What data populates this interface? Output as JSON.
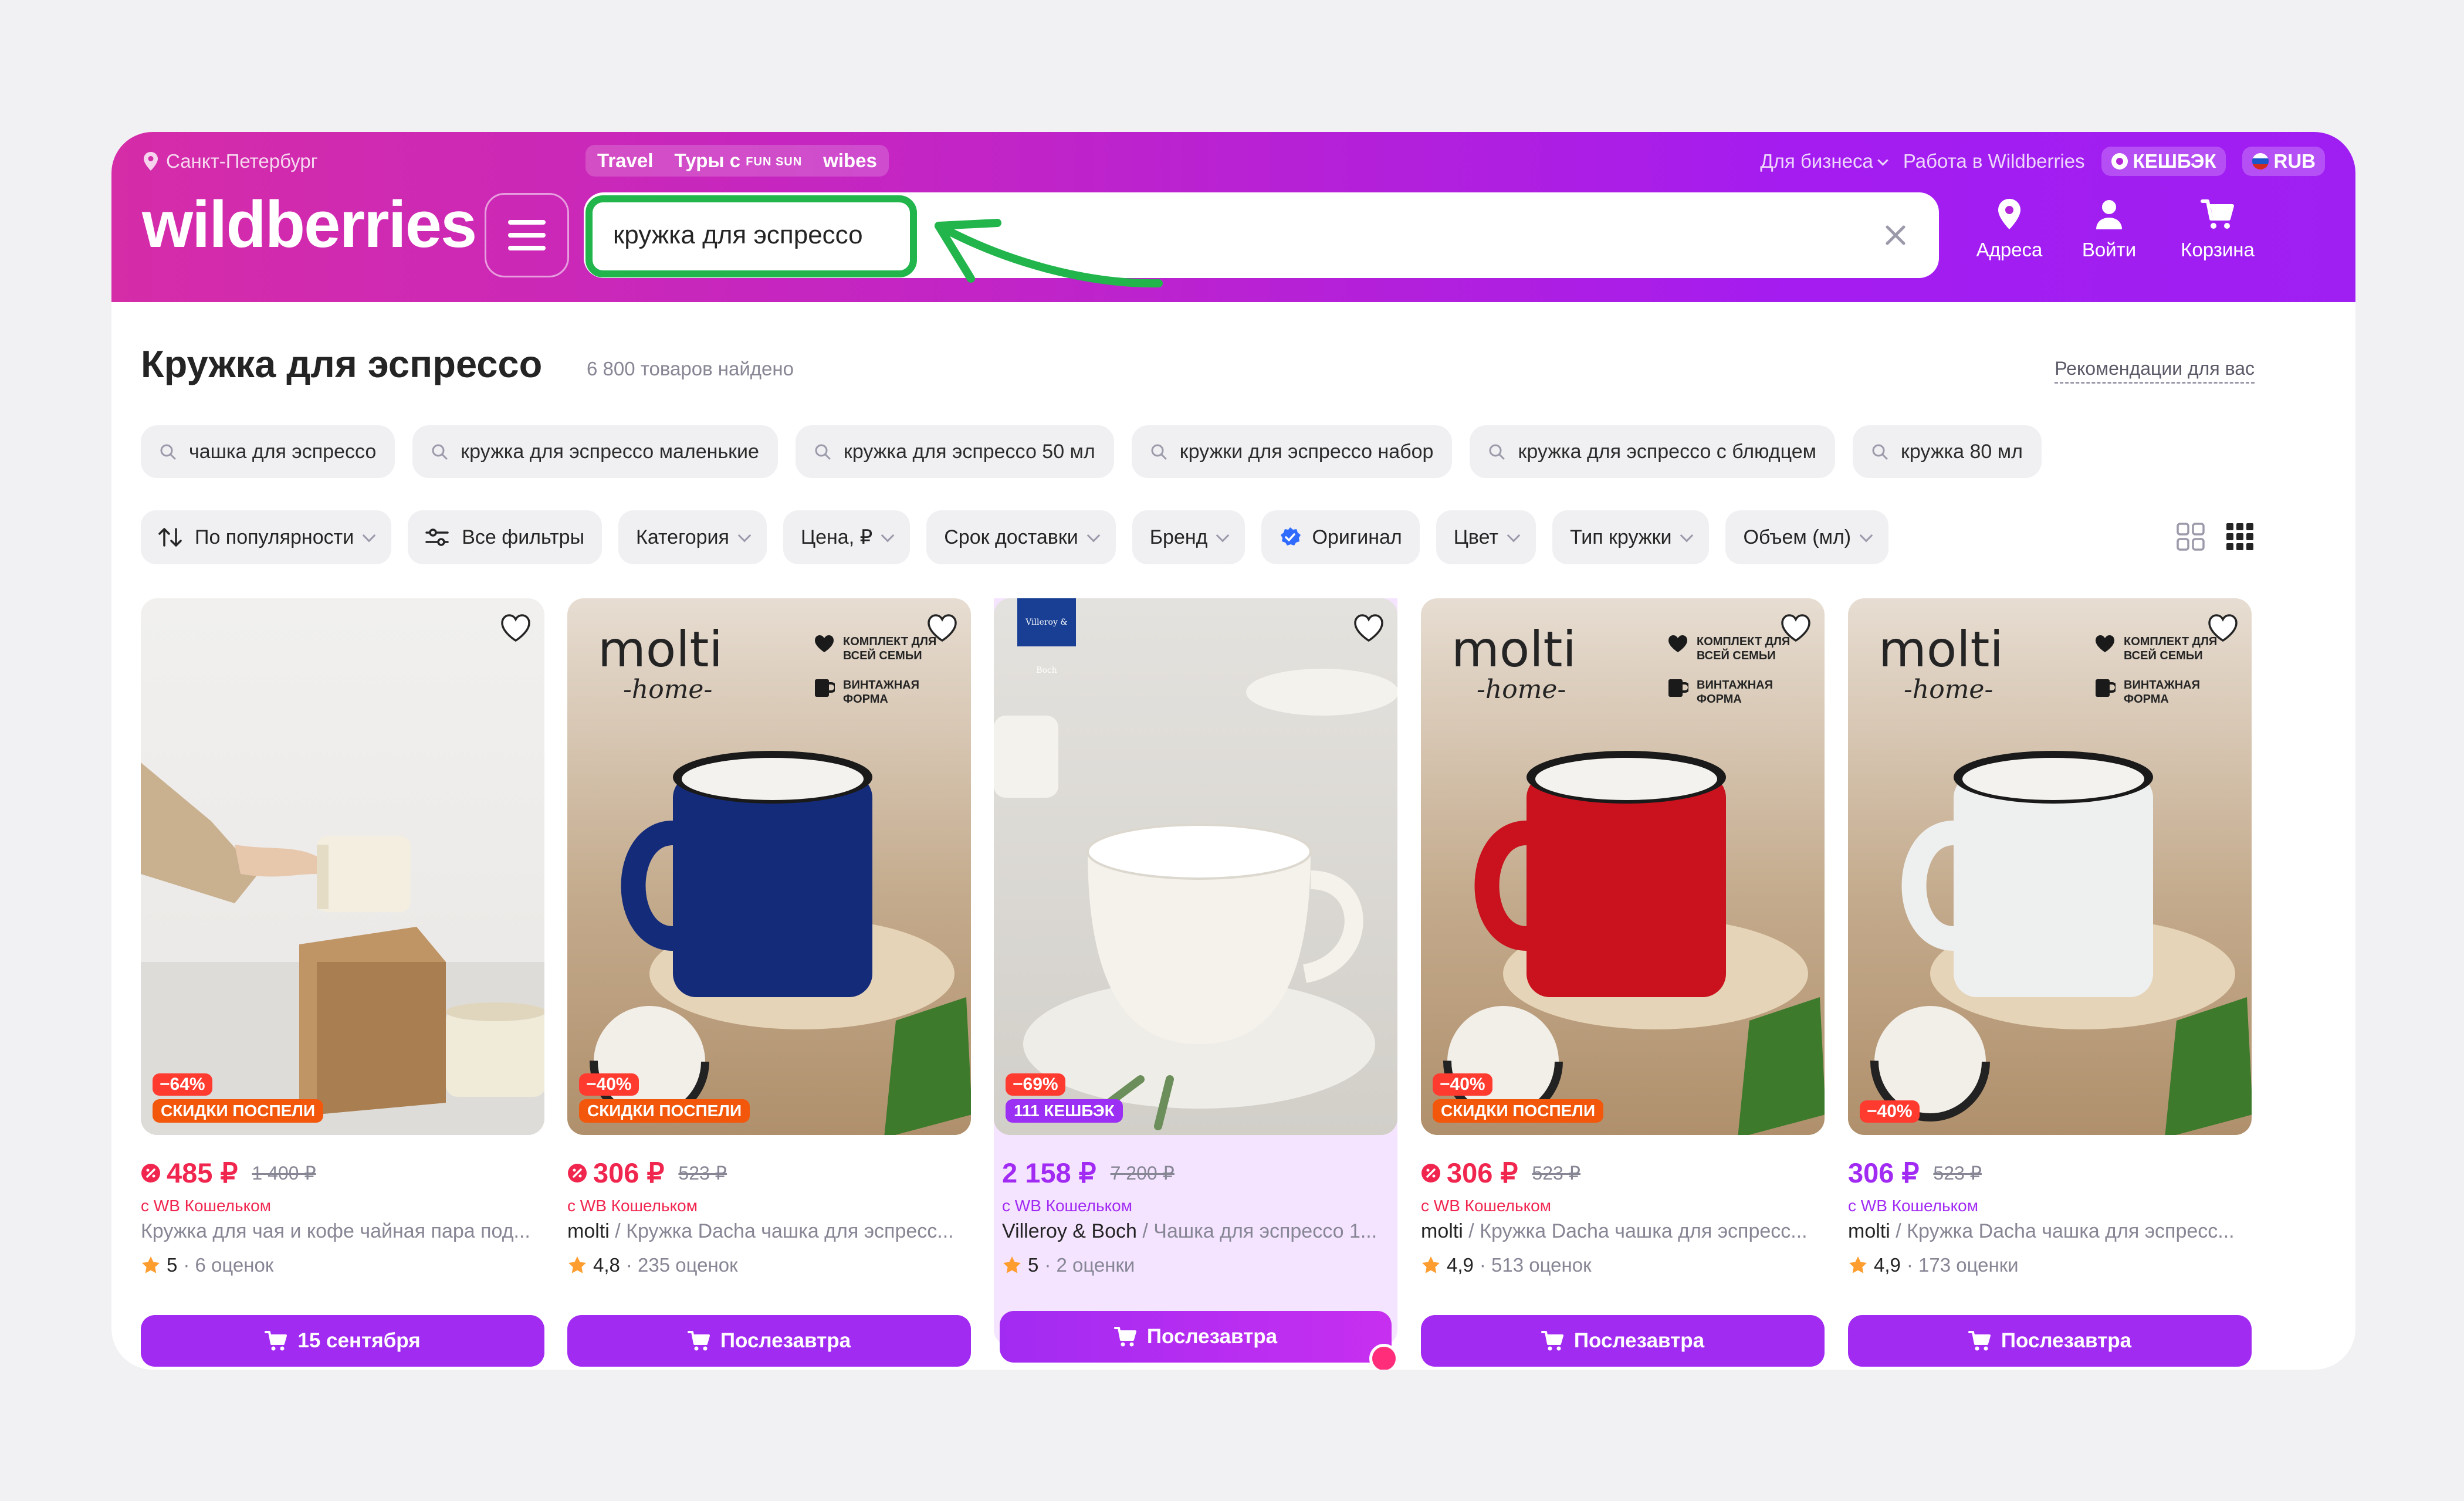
{
  "header": {
    "city": "Санкт-Петербург",
    "promo": {
      "travel": "Travel",
      "tours": "Туры с",
      "sun_logo": "FUN SUN",
      "wibes": "wibes"
    },
    "business": "Для бизнеса",
    "work": "Работа в Wildberries",
    "cashback": "КЕШБЭК",
    "currency": "RUB",
    "logo": "wildberries",
    "search_value": "кружка для эспрессо",
    "addresses": "Адреса",
    "login": "Войти",
    "cart": "Корзина"
  },
  "page": {
    "title": "Кружка для эспрессо",
    "count": "6 800 товаров найдено",
    "recommendations": "Рекомендации для вас"
  },
  "suggestions": [
    "чашка для эспрессо",
    "кружка для эспрессо маленькие",
    "кружка для эспрессо 50 мл",
    "кружки для эспрессо набор",
    "кружка для эспрессо с блюдцем",
    "кружка 80 мл"
  ],
  "filters": {
    "sort": "По популярности",
    "all": "Все фильтры",
    "category": "Категория",
    "price": "Цена, ₽",
    "delivery": "Срок доставки",
    "brand": "Бренд",
    "original": "Оригинал",
    "color": "Цвет",
    "mug_type": "Тип кружки",
    "volume": "Объем (мл)"
  },
  "colors": {
    "brand_from": "#d52ca8",
    "brand_to": "#9f1ff2",
    "accent": "#a22bf2",
    "price_red": "#f0264f",
    "highlight_green": "#21b54c"
  },
  "products": [
    {
      "discount": "−64%",
      "badge": "СКИДКИ ПОСПЕЛИ",
      "price": "485 ₽",
      "old_price": "1 400 ₽",
      "wallet": "с WB Кошельком",
      "brand": "",
      "name": "Кружка для чая и кофе чайная пара под...",
      "rating": "5",
      "reviews": "· 6 оценок",
      "delivery": "15 сентября",
      "mug_color": "#efe8d6"
    },
    {
      "discount": "−40%",
      "badge": "СКИДКИ ПОСПЕЛИ",
      "price": "306 ₽",
      "old_price": "523 ₽",
      "wallet": "с WB Кошельком",
      "brand": "molti",
      "name": " / Кружка Dacha чашка для эспресс...",
      "rating": "4,8",
      "reviews": "· 235 оценок",
      "delivery": "Послезавтра",
      "mug_color": "#142b7a",
      "molti": "molti",
      "molti_sub": "-home-",
      "kit1": "КОМПЛЕКТ ДЛЯ ВСЕЙ СЕМЬИ",
      "kit2": "ВИНТАЖНАЯ ФОРМА"
    },
    {
      "discount": "−69%",
      "badge": "111 КЕШБЭК",
      "price": "2 158 ₽",
      "old_price": "7 200 ₽",
      "wallet": "с WB Кошельком",
      "brand": "Villeroy & Boch",
      "name": " / Чашка для эспрессо 1...",
      "rating": "5",
      "reviews": "· 2 оценки",
      "delivery": "Послезавтра",
      "mug_color": "#f4f2ea",
      "vb_logo": "Villeroy & Boch"
    },
    {
      "discount": "−40%",
      "badge": "СКИДКИ ПОСПЕЛИ",
      "price": "306 ₽",
      "old_price": "523 ₽",
      "wallet": "с WB Кошельком",
      "brand": "molti",
      "name": " / Кружка Dacha чашка для эспресс...",
      "rating": "4,9",
      "reviews": "· 513 оценок",
      "delivery": "Послезавтра",
      "mug_color": "#c9121d",
      "molti": "molti",
      "molti_sub": "-home-",
      "kit1": "КОМПЛЕКТ ДЛЯ ВСЕЙ СЕМЬИ",
      "kit2": "ВИНТАЖНАЯ ФОРМА"
    },
    {
      "discount": "−40%",
      "badge": "",
      "price": "306 ₽",
      "old_price": "523 ₽",
      "wallet": "с WB Кошельком",
      "brand": "molti",
      "name": " / Кружка Dacha чашка для эспресс...",
      "rating": "4,9",
      "reviews": "· 173 оценки",
      "delivery": "Послезавтра",
      "mug_color": "#eef0f0",
      "molti": "molti",
      "molti_sub": "-home-",
      "kit1": "КОМПЛЕКТ ДЛЯ ВСЕЙ СЕМЬИ",
      "kit2": "ВИНТАЖНАЯ ФОРМА"
    }
  ]
}
